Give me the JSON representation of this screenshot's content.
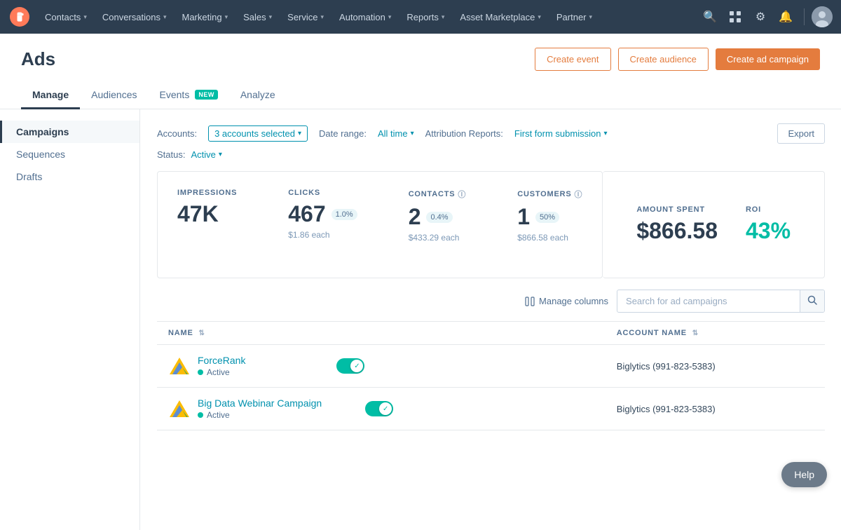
{
  "nav": {
    "items": [
      {
        "label": "Contacts",
        "id": "contacts"
      },
      {
        "label": "Conversations",
        "id": "conversations"
      },
      {
        "label": "Marketing",
        "id": "marketing"
      },
      {
        "label": "Sales",
        "id": "sales"
      },
      {
        "label": "Service",
        "id": "service"
      },
      {
        "label": "Automation",
        "id": "automation"
      },
      {
        "label": "Reports",
        "id": "reports"
      },
      {
        "label": "Asset Marketplace",
        "id": "asset-marketplace"
      },
      {
        "label": "Partner",
        "id": "partner"
      }
    ]
  },
  "page": {
    "title": "Ads",
    "tabs": [
      {
        "label": "Manage",
        "id": "manage",
        "active": true
      },
      {
        "label": "Audiences",
        "id": "audiences",
        "badge": null
      },
      {
        "label": "Events",
        "id": "events",
        "badge": "NEW"
      },
      {
        "label": "Analyze",
        "id": "analyze",
        "badge": null
      }
    ]
  },
  "header_actions": {
    "create_event": "Create event",
    "create_audience": "Create audience",
    "create_campaign": "Create ad campaign"
  },
  "sidebar": {
    "items": [
      {
        "label": "Campaigns",
        "id": "campaigns",
        "active": true
      },
      {
        "label": "Sequences",
        "id": "sequences"
      },
      {
        "label": "Drafts",
        "id": "drafts"
      }
    ]
  },
  "filters": {
    "accounts_label": "Accounts:",
    "accounts_value": "3 accounts selected",
    "date_range_label": "Date range:",
    "date_range_value": "All time",
    "attribution_label": "Attribution Reports:",
    "attribution_value": "First form submission",
    "status_label": "Status:",
    "status_value": "Active",
    "export_label": "Export"
  },
  "stats": {
    "impressions": {
      "label": "IMPRESSIONS",
      "value": "47K"
    },
    "clicks": {
      "label": "CLICKS",
      "value": "467",
      "badge": "1.0%",
      "sub": "$1.86 each"
    },
    "contacts": {
      "label": "CONTACTS",
      "value": "2",
      "badge": "0.4%",
      "sub": "$433.29 each"
    },
    "customers": {
      "label": "CUSTOMERS",
      "value": "1",
      "badge": "50%",
      "sub": "$866.58 each"
    },
    "amount_spent": {
      "label": "AMOUNT SPENT",
      "value": "$866.58"
    },
    "roi": {
      "label": "ROI",
      "value": "43%"
    }
  },
  "table": {
    "manage_columns_label": "Manage columns",
    "search_placeholder": "Search for ad campaigns",
    "columns": [
      {
        "label": "NAME",
        "id": "name"
      },
      {
        "label": "ACCOUNT NAME",
        "id": "account_name"
      }
    ],
    "rows": [
      {
        "id": "forcerank",
        "name": "ForceRank",
        "status": "Active",
        "status_active": true,
        "account": "Biglytics (991-823-5383)",
        "toggle_on": true
      },
      {
        "id": "big-data-webinar",
        "name": "Big Data Webinar Campaign",
        "status": "Active",
        "status_active": true,
        "account": "Biglytics (991-823-5383)",
        "toggle_on": true
      }
    ]
  },
  "help": {
    "label": "Help"
  },
  "colors": {
    "accent": "#e47c3e",
    "teal": "#0091ae",
    "green": "#00bda5",
    "nav_bg": "#2d3e50"
  }
}
